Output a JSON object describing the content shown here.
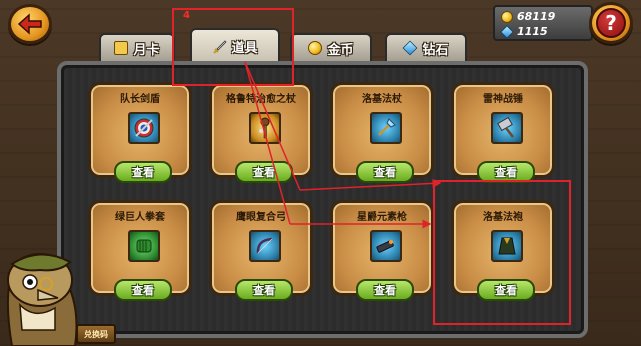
{
  "header": {
    "coins": "68119",
    "gems": "1115",
    "help_symbol": "?"
  },
  "tabs": [
    {
      "label": "月卡",
      "icon": "month-card-icon"
    },
    {
      "label": "道具",
      "icon": "sword-icon",
      "active": true
    },
    {
      "label": "金币",
      "icon": "coin-icon"
    },
    {
      "label": "钻石",
      "icon": "diamond-icon"
    }
  ],
  "items": [
    {
      "name": "队长剑盾",
      "icon": "shield-icon",
      "button": "查看"
    },
    {
      "name": "格鲁特治愈之杖",
      "icon": "staff-icon",
      "button": "查看"
    },
    {
      "name": "洛基法杖",
      "icon": "scepter-icon",
      "button": "查看"
    },
    {
      "name": "雷神战锤",
      "icon": "hammer-icon",
      "button": "查看"
    },
    {
      "name": "绿巨人拳套",
      "icon": "fist-icon",
      "button": "查看"
    },
    {
      "name": "鹰眼复合弓",
      "icon": "bow-icon",
      "button": "查看"
    },
    {
      "name": "星爵元素枪",
      "icon": "gun-icon",
      "button": "查看"
    },
    {
      "name": "洛基法袍",
      "icon": "robe-icon",
      "button": "查看"
    }
  ],
  "character": {
    "tag": "兑换码"
  },
  "annotation": {
    "step_number": "4"
  },
  "colors": {
    "annotation_red": "#e0222a",
    "view_button_green": "#6aac1e",
    "item_card_tan": "#c98d46"
  }
}
